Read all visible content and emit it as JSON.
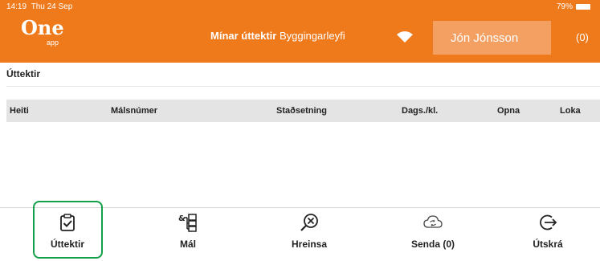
{
  "status_bar": {
    "time": "14:19",
    "date": "Thu 24 Sep",
    "battery": "79%"
  },
  "logo": {
    "main": "One",
    "sub": "app"
  },
  "header": {
    "title_bold": "Mínar úttektir",
    "title_rest": "Byggingarleyfi"
  },
  "user": {
    "name": "Jón Jónsson",
    "count": "(0)"
  },
  "section": {
    "title": "Úttektir"
  },
  "table": {
    "columns": [
      "Heiti",
      "Málsnúmer",
      "Staðsetning",
      "Dags./kl.",
      "Opna",
      "Loka"
    ]
  },
  "tabs": [
    {
      "label": "Úttektir",
      "icon": "clipboard-check-icon",
      "active": true
    },
    {
      "label": "Mál",
      "icon": "case-tree-icon",
      "active": false
    },
    {
      "label": "Hreinsa",
      "icon": "clear-search-icon",
      "active": false
    },
    {
      "label": "Senda (0)",
      "icon": "cloud-sync-icon",
      "active": false
    },
    {
      "label": "Útskrá",
      "icon": "logout-icon",
      "active": false
    }
  ],
  "colors": {
    "header": "#ee7a1c",
    "user_box": "#f4a062",
    "active_tab_border": "#14a04a"
  }
}
